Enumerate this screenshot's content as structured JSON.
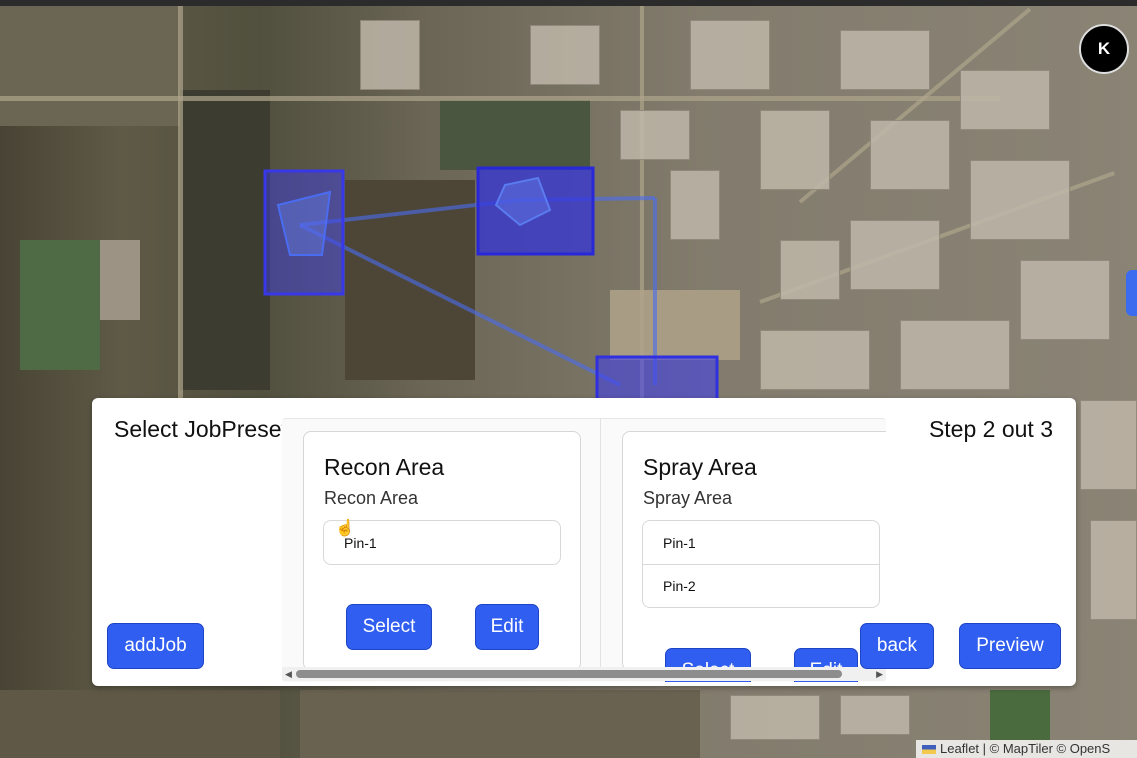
{
  "avatar": {
    "initial": "K"
  },
  "attribution": {
    "text": "Leaflet | © MapTiler © OpenS"
  },
  "panel": {
    "title": "Select JobPreset",
    "step_text": "Step 2 out 3",
    "add_job_label": "addJob",
    "back_label": "back",
    "preview_label": "Preview"
  },
  "cards": [
    {
      "title": "Recon Area",
      "subtitle": "Recon Area",
      "pins": [
        "Pin-1"
      ],
      "select_label": "Select",
      "edit_label": "Edit"
    },
    {
      "title": "Spray Area",
      "subtitle": "Spray Area",
      "pins": [
        "Pin-1",
        "Pin-2"
      ],
      "select_label": "Select",
      "edit_label": "Edit"
    }
  ],
  "colors": {
    "accent": "#2f5ef0",
    "polygon_fill": "#3c3cf0",
    "route_line": "#4a6cf0"
  },
  "icons": {
    "cursor": "hand-pointer-icon",
    "attribution_flag": "ukraine-flag-icon"
  }
}
